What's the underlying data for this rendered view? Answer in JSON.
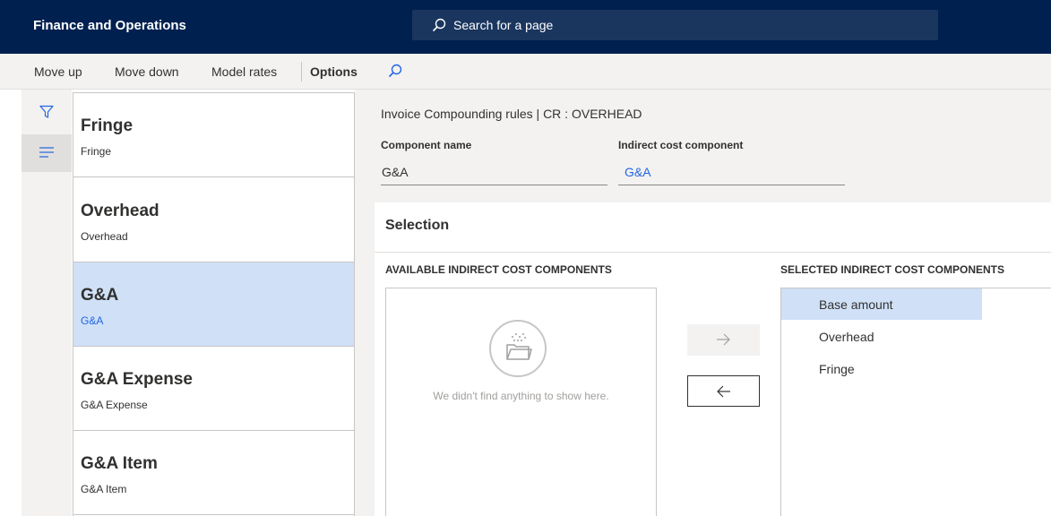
{
  "app": {
    "title": "Finance and Operations"
  },
  "search": {
    "placeholder": "Search for a page"
  },
  "actions": {
    "move_up": "Move up",
    "move_down": "Move down",
    "model_rates": "Model rates",
    "options": "Options"
  },
  "list": {
    "items": [
      {
        "title": "Fringe",
        "subtitle": "Fringe"
      },
      {
        "title": "Overhead",
        "subtitle": "Overhead"
      },
      {
        "title": "G&A",
        "subtitle": "G&A"
      },
      {
        "title": "G&A Expense",
        "subtitle": "G&A Expense"
      },
      {
        "title": "G&A Item",
        "subtitle": "G&A Item"
      }
    ],
    "selected_index": 2
  },
  "details": {
    "breadcrumb": "Invoice Compounding rules  |  CR : OVERHEAD",
    "component_name_label": "Component name",
    "component_name_value": "G&A",
    "indirect_label": "Indirect cost component",
    "indirect_value": "G&A"
  },
  "selection": {
    "title": "Selection",
    "available_header": "AVAILABLE INDIRECT COST COMPONENTS",
    "selected_header": "SELECTED INDIRECT COST COMPONENTS",
    "empty_text": "We didn't find anything to show here.",
    "selected_items": [
      "Base amount",
      "Overhead",
      "Fringe"
    ]
  },
  "colors": {
    "navbar": "#002050",
    "accent": "#2266e3",
    "selected_bg": "#cfe0f7"
  },
  "icons": [
    "search-icon",
    "filter-icon",
    "list-icon",
    "empty-folder-icon",
    "arrow-right-icon",
    "arrow-left-icon"
  ]
}
